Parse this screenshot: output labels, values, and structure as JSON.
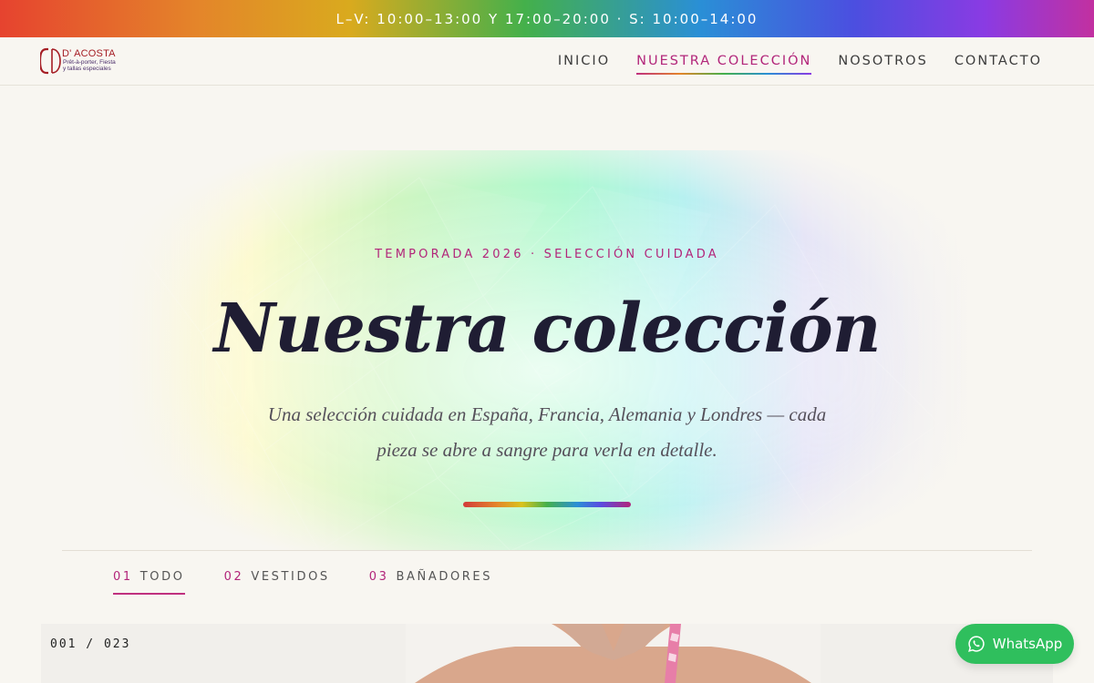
{
  "topbar": {
    "hours": "L–V: 10:00–13:00 Y 17:00–20:00 · S: 10:00–14:00"
  },
  "brand": {
    "name": "D' ACOSTA",
    "tagline_line1": "Prêt-à-porter, Fiesta",
    "tagline_line2": "y tallas especiales",
    "color": "#a51d24"
  },
  "nav": {
    "items": [
      {
        "label": "INICIO",
        "active": false
      },
      {
        "label": "NUESTRA COLECCIÓN",
        "active": true
      },
      {
        "label": "NOSOTROS",
        "active": false
      },
      {
        "label": "CONTACTO",
        "active": false
      }
    ]
  },
  "hero": {
    "eyebrow": "TEMPORADA 2026 · SELECCIÓN CUIDADA",
    "title": "Nuestra colección",
    "subtitle": "Una selección cuidada en España, Francia, Alemania y Londres — cada pieza se abre a sangre para verla en detalle."
  },
  "filters": {
    "tabs": [
      {
        "num": "01",
        "label": "TODO",
        "active": true
      },
      {
        "num": "02",
        "label": "VESTIDOS",
        "active": false
      },
      {
        "num": "03",
        "label": "BAÑADORES",
        "active": false
      }
    ]
  },
  "gallery": {
    "counter": "001 / 023"
  },
  "whatsapp": {
    "label": "WhatsApp",
    "color": "#2fbf5d"
  },
  "colors": {
    "accent": "#b2257a",
    "background": "#f8f6f1",
    "title": "#1f1d33"
  }
}
